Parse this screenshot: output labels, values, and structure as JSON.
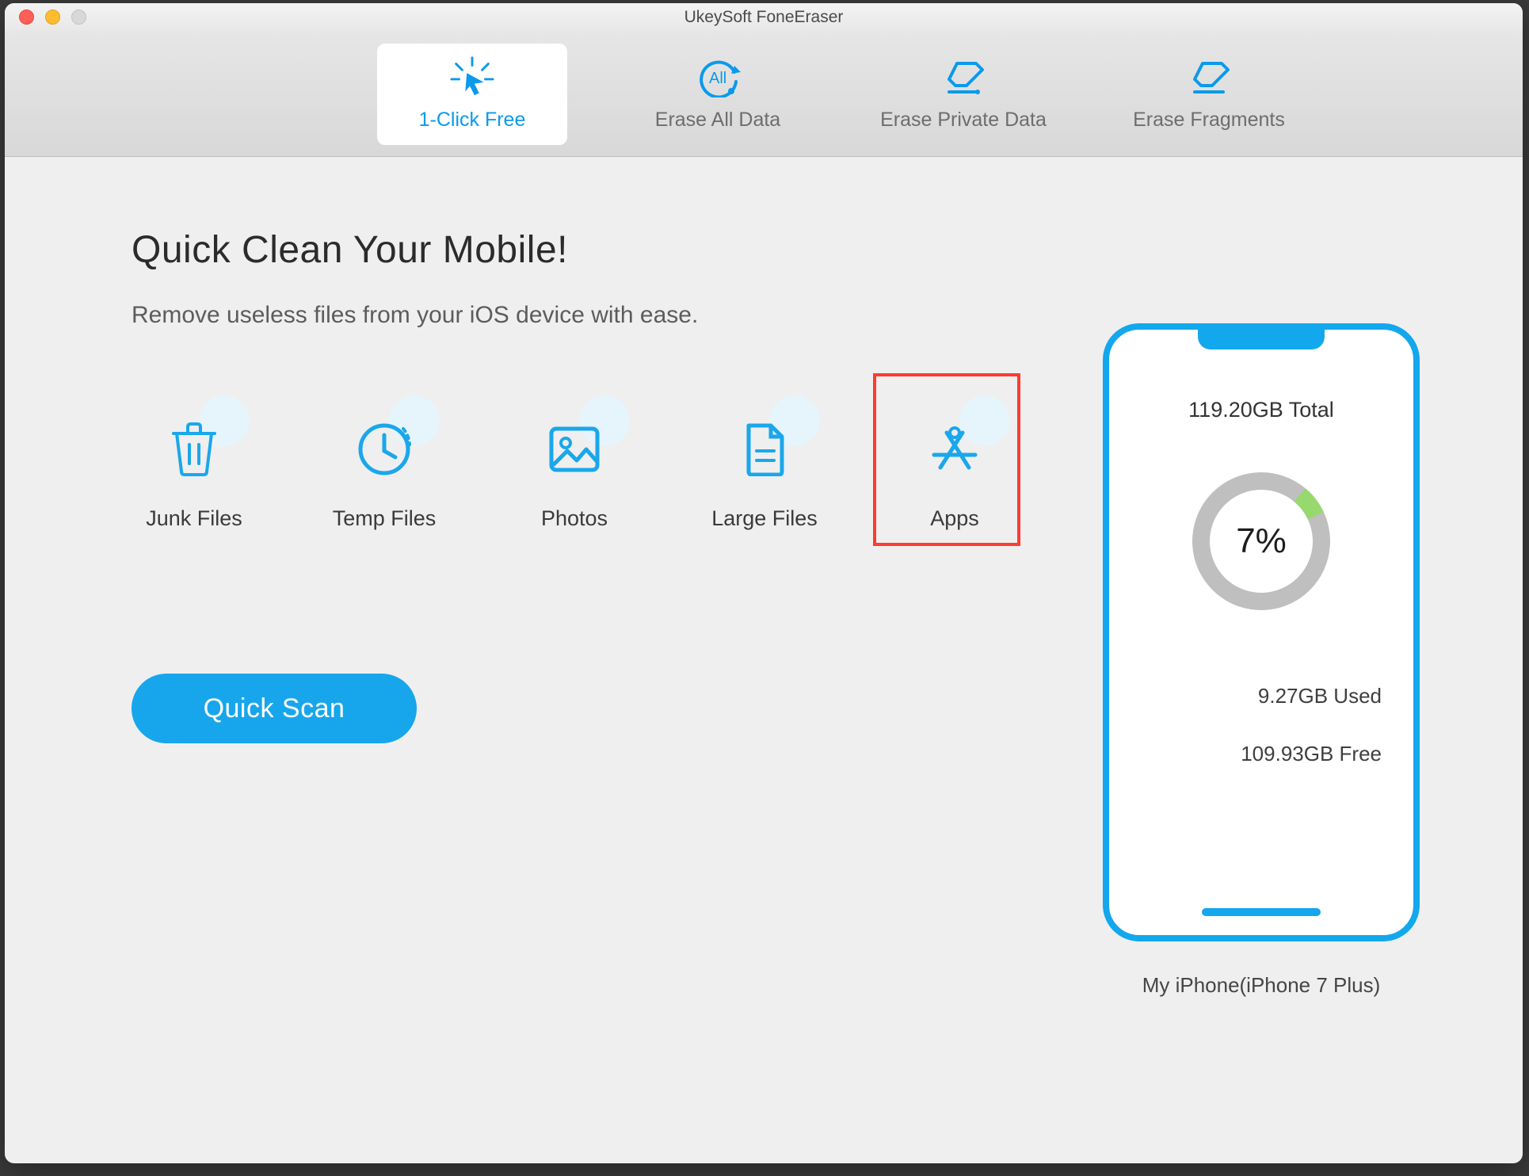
{
  "window": {
    "title": "UkeySoft FoneEraser"
  },
  "tabs": [
    {
      "label": "1-Click Free",
      "active": true
    },
    {
      "label": "Erase All Data",
      "active": false
    },
    {
      "label": "Erase Private Data",
      "active": false
    },
    {
      "label": "Erase Fragments",
      "active": false
    }
  ],
  "main": {
    "heading": "Quick Clean Your Mobile!",
    "subheading": "Remove useless files from your iOS device with ease.",
    "categories": [
      {
        "label": "Junk Files",
        "highlighted": false
      },
      {
        "label": "Temp Files",
        "highlighted": false
      },
      {
        "label": "Photos",
        "highlighted": false
      },
      {
        "label": "Large Files",
        "highlighted": false
      },
      {
        "label": "Apps",
        "highlighted": true
      }
    ],
    "scan_button": "Quick Scan"
  },
  "device": {
    "total": "119.20GB Total",
    "used_percent": "7%",
    "used_percent_num": 7,
    "used": "9.27GB Used",
    "free": "109.93GB Free",
    "name": "My iPhone(iPhone 7 Plus)"
  },
  "colors": {
    "accent": "#13a7ed",
    "ring_track": "#bfbfbf",
    "ring_fill": "#97d96f",
    "highlight": "#ff3b30"
  }
}
